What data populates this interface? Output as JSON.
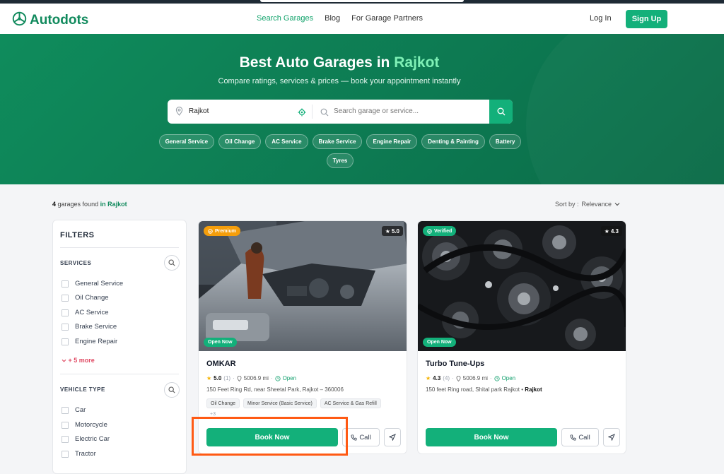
{
  "brand": {
    "name": "Autodots",
    "color": "#118a5d",
    "accent": "#13b07a"
  },
  "nav": {
    "links": [
      "Search Garages",
      "Blog",
      "For Garage Partners"
    ],
    "login": "Log In",
    "signup": "Sign Up"
  },
  "hero": {
    "title_prefix": "Best Auto Garages in",
    "title_city": "Rajkot",
    "subtitle": "Compare ratings, services & prices — book your appointment instantly",
    "location_value": "Rajkot",
    "search_placeholder": "Search garage or service...",
    "chips": [
      "General Service",
      "Oil Change",
      "AC Service",
      "Brake Service",
      "Engine Repair",
      "Denting & Painting",
      "Battery",
      "Tyres"
    ]
  },
  "results": {
    "count": "4",
    "found_text": "garages found",
    "in_city": "in Rajkot",
    "sort_label": "Sort by :",
    "sort_value": "Relevance"
  },
  "filters": {
    "title": "FILTERS",
    "services_title": "SERVICES",
    "services": [
      "General Service",
      "Oil Change",
      "AC Service",
      "Brake Service",
      "Engine Repair"
    ],
    "more": "+ 5 more",
    "vehicle_title": "VEHICLE TYPE",
    "vehicles": [
      "Car",
      "Motorcycle",
      "Electric Car",
      "Tractor"
    ]
  },
  "garages": [
    {
      "badge": "Premium",
      "rating_pill": "5.0",
      "status": "Open Now",
      "name": "OMKAR",
      "rating": "5.0",
      "reviews": "(1)",
      "distance": "5006.9 mi",
      "open": "Open",
      "address": "150 Feet Ring Rd, near Sheetal Park, Rajkot – 360006",
      "tags": [
        "Oil Change",
        "Minor Service (Basic Service)",
        "AC Service & Gas Refill"
      ],
      "more_tags": "+3",
      "book": "Book Now",
      "call": "Call"
    },
    {
      "badge": "Verified",
      "rating_pill": "4.3",
      "status": "Open Now",
      "name": "Turbo Tune-Ups",
      "rating": "4.3",
      "reviews": "(4)",
      "distance": "5006.9 mi",
      "open": "Open",
      "address": "150 feet Ring road, Shital park Rajkot •",
      "address_city": "Rajkot",
      "book": "Book Now",
      "call": "Call"
    }
  ],
  "icons": [
    "logo-icon",
    "location-pin-icon",
    "target-icon",
    "search-icon",
    "chevron-down-icon",
    "star-icon",
    "pin-icon",
    "clock-icon",
    "phone-icon",
    "direction-icon",
    "check-badge-icon"
  ]
}
